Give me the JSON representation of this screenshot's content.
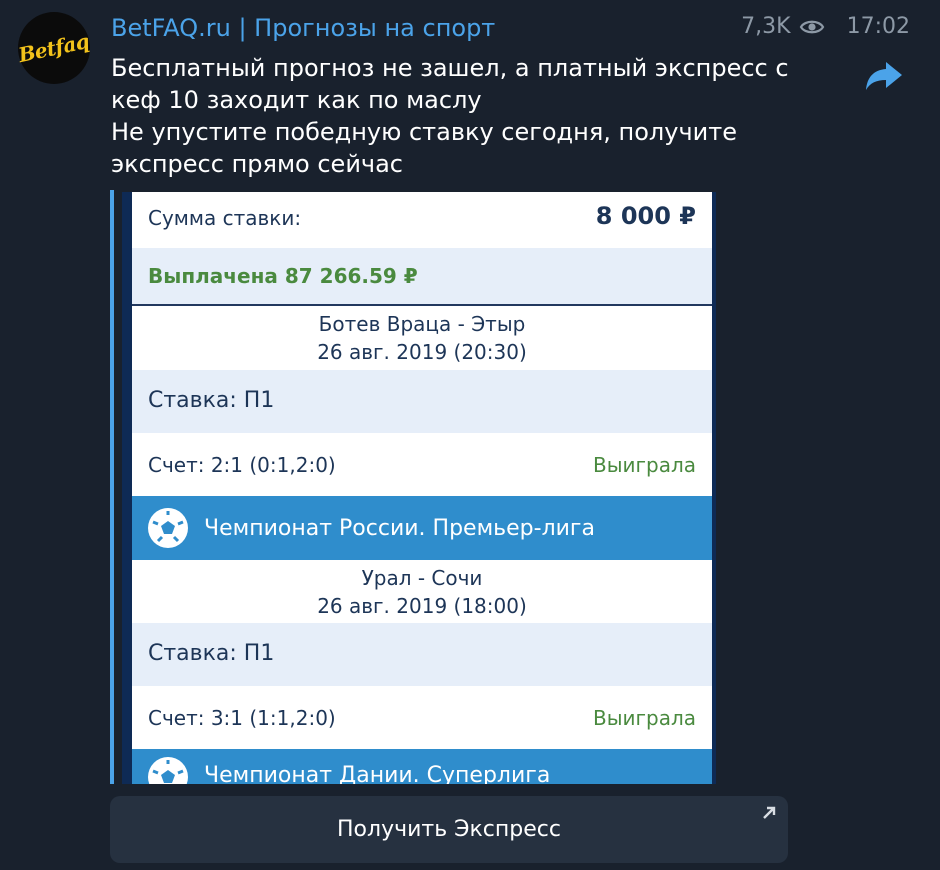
{
  "channel": {
    "avatar_text": "Betfaq",
    "name": "BetFAQ.ru | Прогнозы на спорт",
    "views": "7,3K",
    "time": "17:02"
  },
  "message": {
    "lines": [
      "Бесплатный прогноз не зашел, а платный экспресс с",
      "кеф 10 заходит как по маслу",
      "Не упустите победную ставку сегодня, получите",
      "экспресс прямо сейчас"
    ]
  },
  "bet_slip": {
    "stake_label": "Сумма ставки:",
    "stake_value": "8 000 ₽",
    "payout": "Выплачена 87 266.59 ₽",
    "matches": [
      {
        "teams": "Ботев Враца - Этыр",
        "date": "26 авг. 2019 (20:30)",
        "bet": "Ставка: П1",
        "score": "Счет: 2:1 (0:1,2:0)",
        "result": "Выиграла"
      },
      {
        "league": "Чемпионат России. Премьер-лига",
        "teams": "Урал - Сочи",
        "date": "26 авг. 2019 (18:00)",
        "bet": "Ставка: П1",
        "score": "Счет: 3:1 (1:1,2:0)",
        "result": "Выиграла"
      }
    ],
    "next_league": "Чемпионат Дании. Суперлига"
  },
  "button": {
    "label": "Получить Экспресс"
  },
  "colors": {
    "background": "#19212d",
    "accent": "#4ba3e9",
    "win_green": "#4a8a3f",
    "league_blue": "#2f8dcc"
  }
}
